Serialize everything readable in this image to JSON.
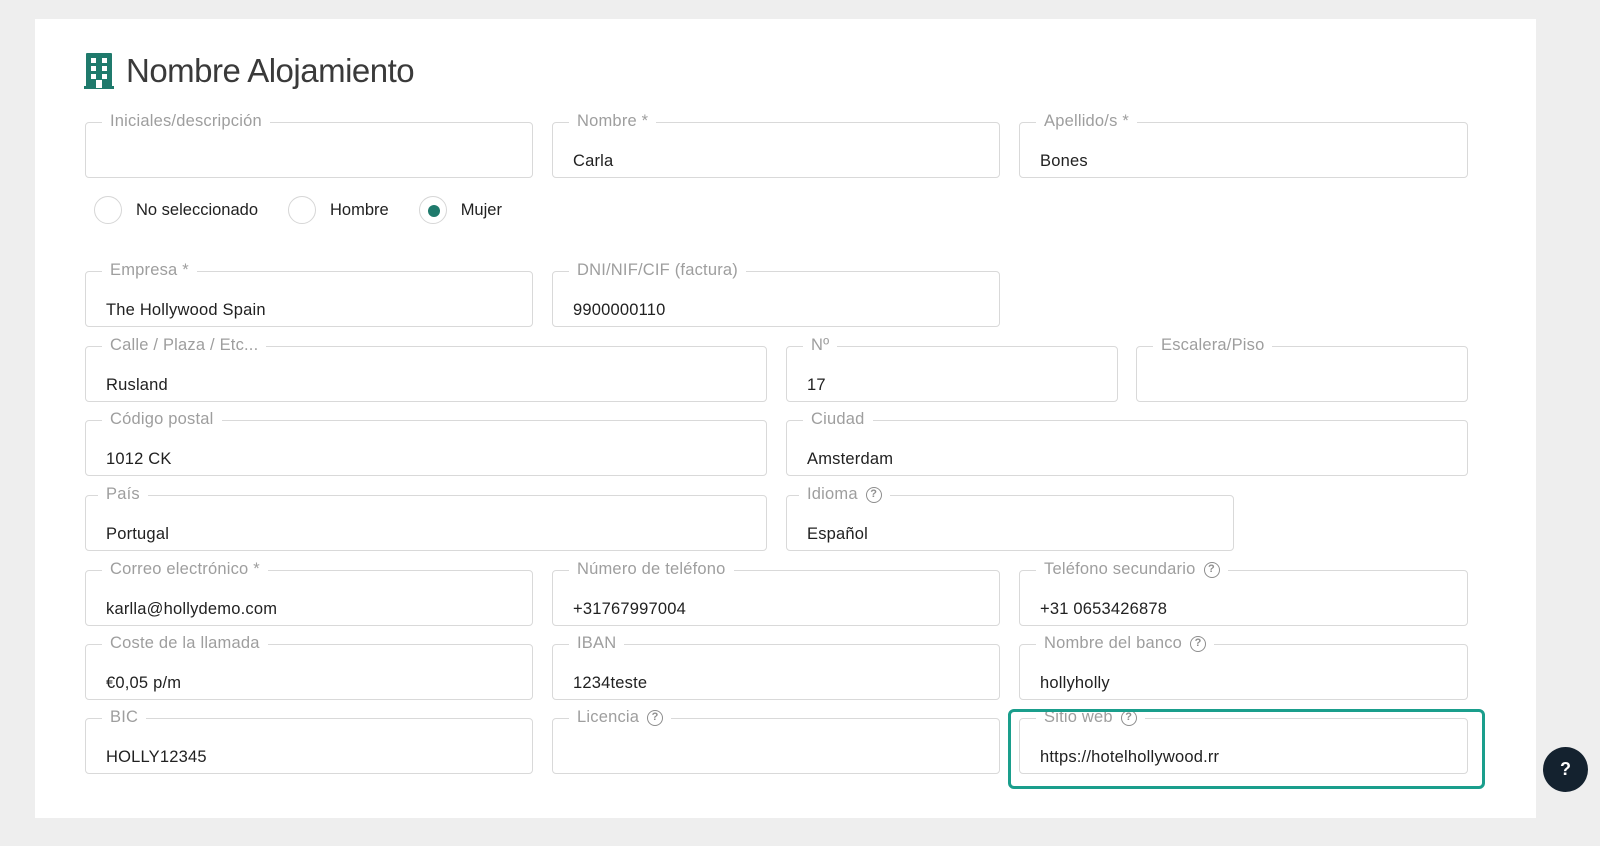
{
  "header": {
    "title": "Nombre Alojamiento",
    "icon": "building-icon",
    "accent": "#1f7a6c"
  },
  "fields": {
    "initials": {
      "label": "Iniciales/descripción",
      "value": ""
    },
    "first_name": {
      "label": "Nombre *",
      "value": "Carla"
    },
    "last_name": {
      "label": "Apellido/s *",
      "value": "Bones"
    },
    "company": {
      "label": "Empresa *",
      "value": "The Hollywood Spain"
    },
    "tax_id": {
      "label": "DNI/NIF/CIF (factura)",
      "value": "9900000110"
    },
    "street": {
      "label": "Calle / Plaza / Etc...",
      "value": "Rusland"
    },
    "number": {
      "label": "Nº",
      "value": "17"
    },
    "floor": {
      "label": "Escalera/Piso",
      "value": ""
    },
    "postal_code": {
      "label": "Código postal",
      "value": "1012 CK"
    },
    "city": {
      "label": "Ciudad",
      "value": "Amsterdam"
    },
    "country": {
      "label": "País",
      "value": "Portugal"
    },
    "language": {
      "label": "Idioma",
      "value": "Español"
    },
    "email": {
      "label": "Correo electrónico *",
      "value": "karlla@hollydemo.com"
    },
    "phone": {
      "label": "Número de teléfono",
      "value": "+31767997004"
    },
    "phone2": {
      "label": "Teléfono secundario",
      "value": "+31 0653426878"
    },
    "call_cost": {
      "label": "Coste de la llamada",
      "value": "€0,05 p/m"
    },
    "iban": {
      "label": "IBAN",
      "value": "1234teste"
    },
    "bank_name": {
      "label": "Nombre del banco",
      "value": "hollyholly"
    },
    "bic": {
      "label": "BIC",
      "value": "HOLLY12345"
    },
    "license": {
      "label": "Licencia",
      "value": ""
    },
    "website": {
      "label": "Sitio web",
      "value": "https://hotelhollywood.rr"
    }
  },
  "gender": {
    "options": [
      "No seleccionado",
      "Hombre",
      "Mujer"
    ],
    "selected": "Mujer"
  },
  "help_glyph": "?",
  "fab": {
    "label": "?"
  },
  "colors": {
    "highlight": "#1a9e8c",
    "fab_bg": "#14222f"
  }
}
